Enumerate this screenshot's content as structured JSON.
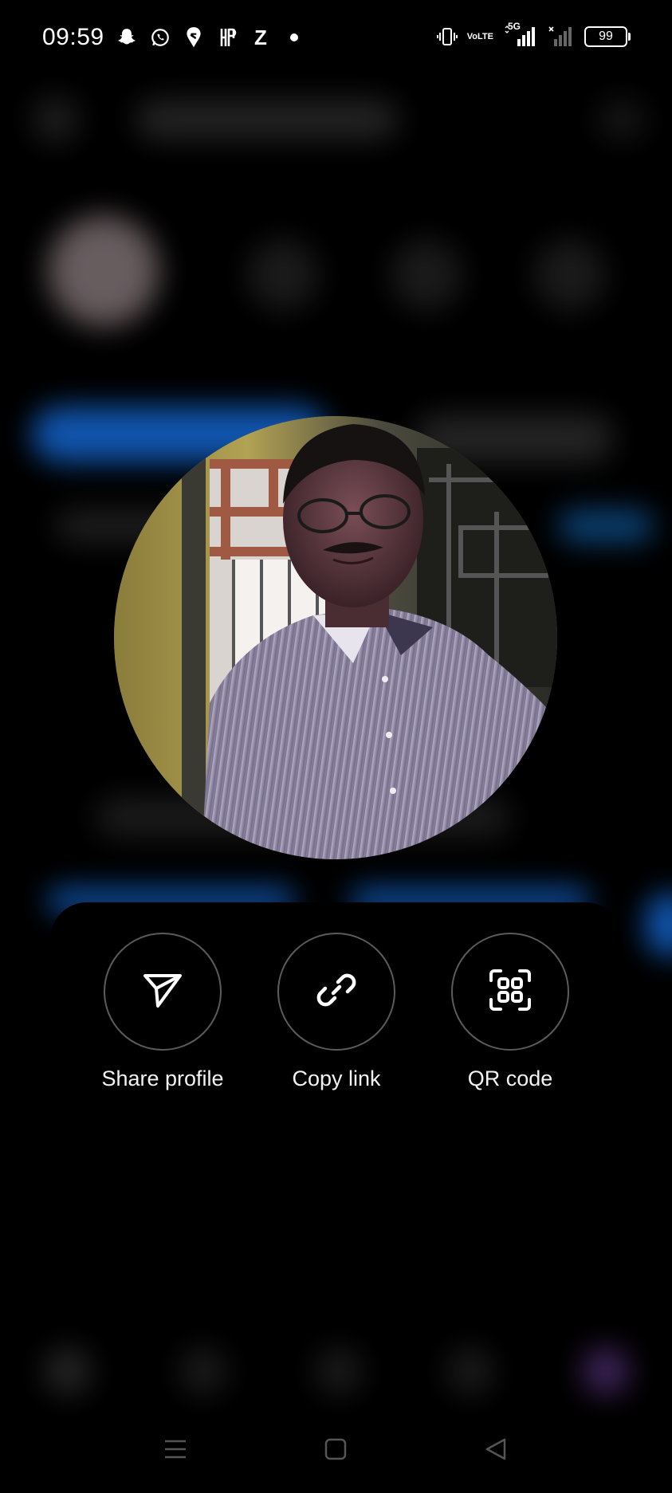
{
  "status_bar": {
    "time": "09:59",
    "notification_icons": [
      "snapchat-icon",
      "whatsapp-icon",
      "swiggy-icon",
      "hp-icon",
      "zomato-icon",
      "dot-icon"
    ],
    "zomato_glyph": "Z",
    "volte_line1": "Vo",
    "volte_line2": "LTE",
    "network_label": "5G",
    "battery_level": "99"
  },
  "avatar": {
    "description_icon": "profile-photo"
  },
  "actions": [
    {
      "label": "Share profile",
      "icon": "paper-plane-icon"
    },
    {
      "label": "Copy link",
      "icon": "link-icon"
    },
    {
      "label": "QR code",
      "icon": "qr-scan-icon"
    }
  ],
  "colors": {
    "background": "#000000",
    "accent_blue": "#1877f2",
    "circle_border": "#5b5b5b",
    "label": "#f2f2f2"
  },
  "system_nav": [
    "menu-icon",
    "home-icon",
    "back-icon"
  ]
}
